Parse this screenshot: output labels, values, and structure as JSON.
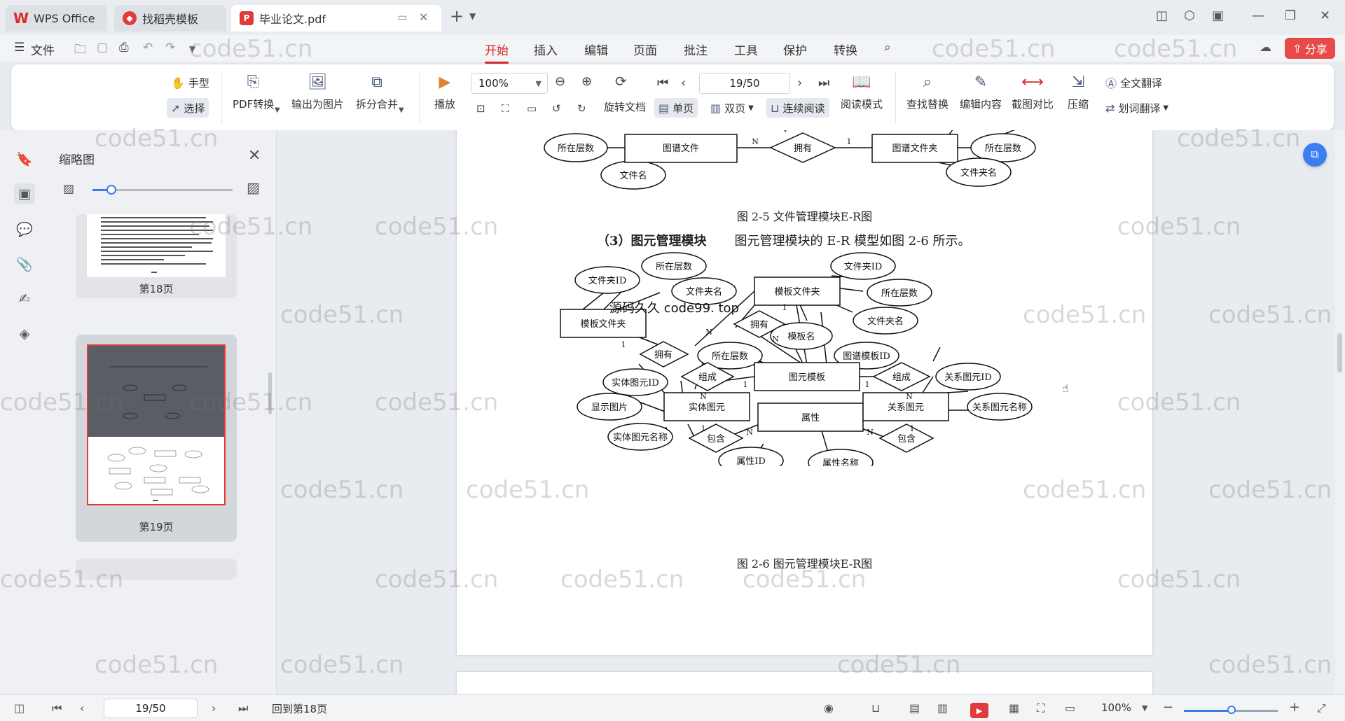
{
  "tabs": {
    "wps": "WPS Office",
    "template": "找稻壳模板",
    "pdf": "毕业论文.pdf"
  },
  "menu": {
    "file": "文件",
    "items": [
      "开始",
      "插入",
      "编辑",
      "页面",
      "批注",
      "工具",
      "保护",
      "转换"
    ],
    "active": "开始",
    "share": "分享"
  },
  "ribbon": {
    "hand": "手型",
    "select": "选择",
    "pdf_convert": "PDF转换",
    "export_image": "输出为图片",
    "split_merge": "拆分合并",
    "play": "播放",
    "zoom": "100%",
    "page": "19/50",
    "rotate": "旋转文档",
    "single": "单页",
    "double": "双页",
    "continuous": "连续阅读",
    "read_mode": "阅读模式",
    "find_replace": "查找替换",
    "edit_content": "编辑内容",
    "compare": "截图对比",
    "compress": "压缩",
    "translate_full": "全文翻译",
    "translate_word": "划词翻译"
  },
  "panel": {
    "title": "缩略图",
    "thumbs": [
      {
        "label": "第18页"
      },
      {
        "label": "第19页"
      }
    ]
  },
  "document": {
    "fig25_caption": "图 2-5  文件管理模块E-R图",
    "section_num": "（3）图元管理模块",
    "section_text": "图元管理模块的 E-R 模型如图  2-6 所示。",
    "fig26_caption": "图 2-6  图元管理模块E-R图",
    "overlay": "源码久久   code99. top",
    "fig25": {
      "entities": [
        "图谱文件",
        "图谱文件夹"
      ],
      "relations": [
        "拥有"
      ],
      "attributes": [
        "所在层数",
        "文件名",
        "所在层数",
        "文件夹名"
      ],
      "cardinality": [
        "N",
        "1"
      ]
    },
    "fig26": {
      "entities": [
        "模板文件夹",
        "模板文件夹",
        "图元模板",
        "实体图元",
        "关系图元",
        "属性"
      ],
      "relations": [
        "拥有",
        "拥有",
        "组成",
        "组成",
        "包含",
        "包含"
      ],
      "attributes": [
        "文件夹ID",
        "所在层数",
        "文件夹名",
        "文件夹ID",
        "所在层数",
        "文件夹名",
        "模板名",
        "所在层数",
        "图谱模板ID",
        "实体图元ID",
        "显示图片",
        "实体图元名称",
        "关系图元ID",
        "关系图元名称",
        "属性ID",
        "属性名称"
      ],
      "cardinality": [
        "1",
        "N",
        "1",
        "N",
        "N",
        "1",
        "N",
        "1",
        "1",
        "N",
        "N",
        "1"
      ]
    }
  },
  "status": {
    "page": "19/50",
    "back": "回到第18页",
    "zoom": "100%"
  },
  "watermark": "code51.cn"
}
